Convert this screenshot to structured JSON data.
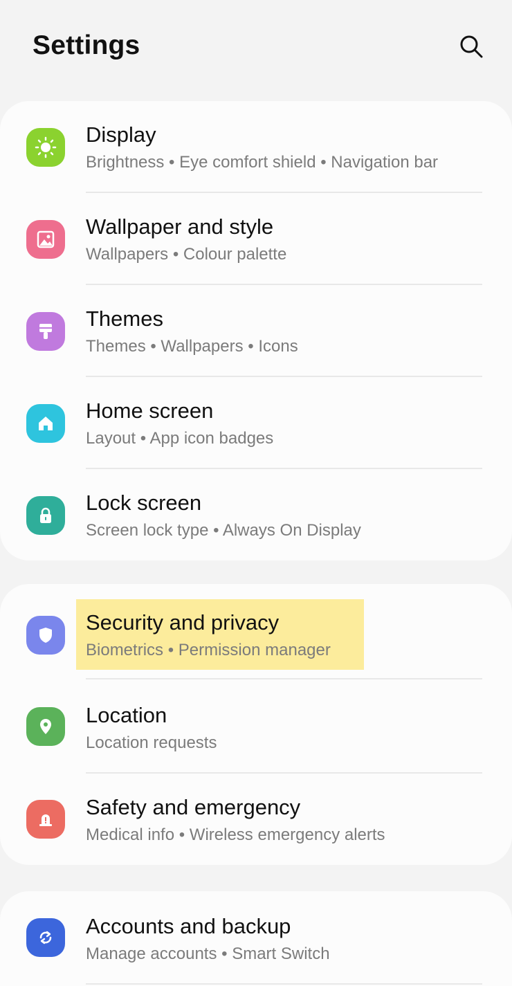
{
  "header": {
    "title": "Settings",
    "search_icon": "search-icon"
  },
  "groups": [
    {
      "items": [
        {
          "title": "Display",
          "subtitle": "Brightness  •  Eye comfort shield  •  Navigation bar",
          "icon": "sun-icon",
          "color": "#8bd22f"
        },
        {
          "title": "Wallpaper and style",
          "subtitle": "Wallpapers  •  Colour palette",
          "icon": "image-icon",
          "color": "#ee6e8e"
        },
        {
          "title": "Themes",
          "subtitle": "Themes  •  Wallpapers  •  Icons",
          "icon": "paintbrush-icon",
          "color": "#c07ade"
        },
        {
          "title": "Home screen",
          "subtitle": "Layout  •  App icon badges",
          "icon": "home-icon",
          "color": "#2ec4de"
        },
        {
          "title": "Lock screen",
          "subtitle": "Screen lock type  •  Always On Display",
          "icon": "lock-icon",
          "color": "#2fae9a"
        }
      ]
    },
    {
      "items": [
        {
          "title": "Security and privacy",
          "subtitle": "Biometrics  •  Permission manager",
          "icon": "shield-icon",
          "color": "#7a86ec",
          "highlighted": true
        },
        {
          "title": "Location",
          "subtitle": "Location requests",
          "icon": "location-pin-icon",
          "color": "#5bb25a"
        },
        {
          "title": "Safety and emergency",
          "subtitle": "Medical info  •  Wireless emergency alerts",
          "icon": "alert-icon",
          "color": "#ec6c62"
        }
      ]
    },
    {
      "items": [
        {
          "title": "Accounts and backup",
          "subtitle": "Manage accounts  •  Smart Switch",
          "icon": "sync-icon",
          "color": "#3c66dc"
        }
      ]
    }
  ],
  "colors": {
    "background": "#f3f3f3",
    "card": "#fcfcfc",
    "highlight": "#fcec9c",
    "subtitle_text": "#7b7b7b"
  }
}
